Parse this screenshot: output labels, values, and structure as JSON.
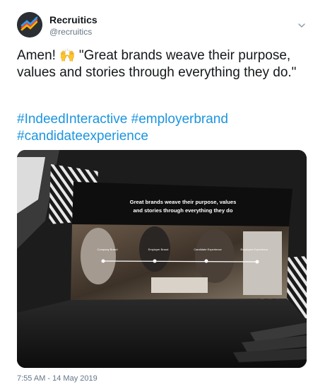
{
  "account": {
    "name": "Recruitics",
    "handle": "@recruitics"
  },
  "tweet": {
    "text_before_emoji": "Amen! ",
    "emoji": "🙌",
    "text_after_emoji": " \"Great brands weave their purpose, values and stories through everything they do.\"",
    "hashtags": [
      "#IndeedInteractive",
      "#employerbrand",
      "#candidateexperience"
    ]
  },
  "media": {
    "slide_title_line1": "Great brands weave their purpose, values",
    "slide_title_line2": "and stories through everything they do",
    "slide_labels": [
      "Company Brand",
      "Employer Brand",
      "Candidate Experience",
      "Employee Experience"
    ]
  },
  "timestamp": "7:55 AM - 14 May 2019",
  "icons": {
    "caret": "chevron-down-icon",
    "avatar": "recruitics-logo-icon"
  },
  "colors": {
    "link": "#1b95e0",
    "secondary_text": "#657786"
  }
}
